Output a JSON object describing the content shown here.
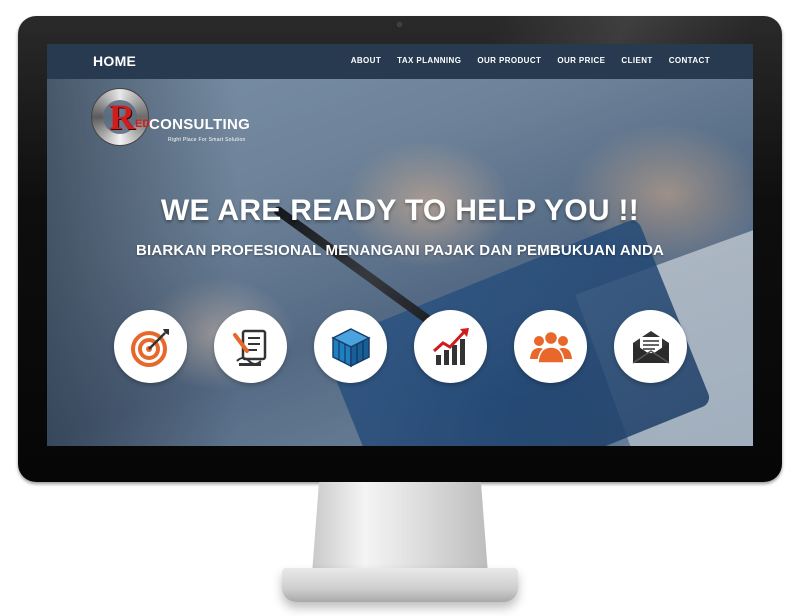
{
  "nav": {
    "home": "HOME",
    "links": [
      "ABOUT",
      "TAX PLANNING",
      "OUR PRODUCT",
      "OUR PRICE",
      "CLIENT",
      "CONTACT"
    ]
  },
  "logo": {
    "letter": "R",
    "ed": "ED",
    "name": "CONSULTING",
    "tagline": "Right Place For Smart Solution"
  },
  "hero": {
    "headline": "WE ARE READY TO HELP YOU !!",
    "subheadline": "BIARKAN PROFESIONAL MENANGANI PAJAK DAN PEMBUKUAN ANDA"
  },
  "features": [
    {
      "icon": "target-icon"
    },
    {
      "icon": "document-sign-icon"
    },
    {
      "icon": "cube-icon"
    },
    {
      "icon": "growth-chart-icon"
    },
    {
      "icon": "team-icon"
    },
    {
      "icon": "mail-icon"
    }
  ],
  "colors": {
    "navbar": "#283a50",
    "brand_red": "#d01c1c",
    "icon_orange": "#e8672a",
    "icon_blue": "#1f7fc0",
    "icon_dark": "#333333"
  }
}
